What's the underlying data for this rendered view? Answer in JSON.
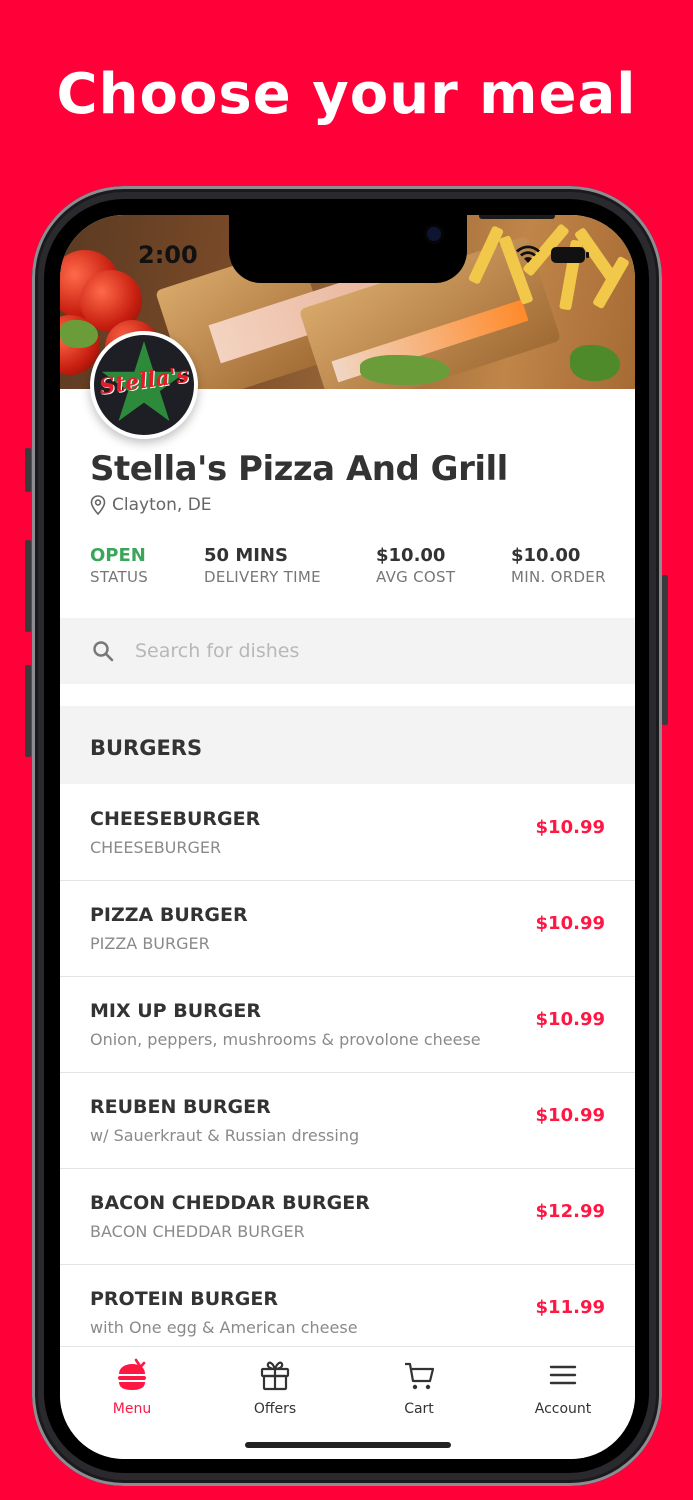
{
  "headline": "Choose your meal",
  "status_bar": {
    "time": "2:00"
  },
  "restaurant": {
    "name": "Stella's Pizza And Grill",
    "location": "Clayton, DE",
    "logo_text": "Stella's"
  },
  "stats": [
    {
      "value": "OPEN",
      "label": "STATUS"
    },
    {
      "value": "50 MINS",
      "label": "DELIVERY TIME"
    },
    {
      "value": "$10.00",
      "label": "AVG COST"
    },
    {
      "value": "$10.00",
      "label": "MIN. ORDER"
    }
  ],
  "search": {
    "placeholder": "Search for dishes"
  },
  "category": {
    "title": "BURGERS"
  },
  "menu_items": [
    {
      "name": "CHEESEBURGER",
      "desc": "CHEESEBURGER",
      "price": "$10.99"
    },
    {
      "name": "PIZZA BURGER",
      "desc": "PIZZA BURGER",
      "price": "$10.99"
    },
    {
      "name": "MIX UP BURGER",
      "desc": "Onion, peppers, mushrooms & provolone cheese",
      "price": "$10.99"
    },
    {
      "name": "REUBEN BURGER",
      "desc": "w/ Sauerkraut & Russian dressing",
      "price": "$10.99"
    },
    {
      "name": "BACON CHEDDAR BURGER",
      "desc": "BACON CHEDDAR BURGER",
      "price": "$12.99"
    },
    {
      "name": "PROTEIN BURGER",
      "desc": "with One egg & American cheese",
      "price": "$11.99"
    }
  ],
  "tabs": [
    {
      "label": "Menu",
      "icon": "food-icon",
      "active": true
    },
    {
      "label": "Offers",
      "icon": "gift-icon"
    },
    {
      "label": "Cart",
      "icon": "cart-icon"
    },
    {
      "label": "Account",
      "icon": "menu-lines-icon"
    }
  ],
  "colors": {
    "accent": "#ff1744",
    "background": "#ff0038",
    "open_status": "#3aa65a"
  }
}
